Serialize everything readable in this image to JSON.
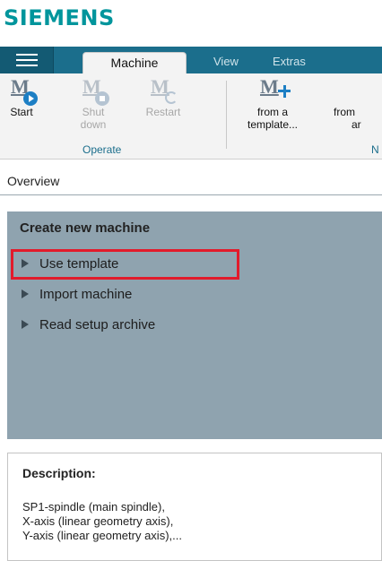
{
  "brand": {
    "logo_text": "SIEMENS",
    "color": "#00959c"
  },
  "tabbar": {
    "tabs": [
      {
        "label": "Machine",
        "active": true
      },
      {
        "label": "View",
        "active": false
      },
      {
        "label": "Extras",
        "active": false
      }
    ]
  },
  "ribbon": {
    "operate_group": {
      "label": "Operate",
      "buttons": [
        {
          "label": "Start",
          "enabled": true,
          "icon": "machine-start-icon"
        },
        {
          "label_line1": "Shut",
          "label_line2": "down",
          "enabled": false,
          "icon": "machine-shutdown-icon"
        },
        {
          "label": "Restart",
          "enabled": false,
          "icon": "machine-restart-icon"
        }
      ]
    },
    "new_group": {
      "label_partial": "N",
      "buttons": [
        {
          "label_line1": "from a",
          "label_line2": "template...",
          "icon": "machine-add-icon"
        },
        {
          "label_line1": "from",
          "label_line2": "ar"
        }
      ]
    }
  },
  "overview": {
    "label": "Overview"
  },
  "create_panel": {
    "title": "Create new machine",
    "items": [
      {
        "label": "Use template",
        "highlighted": true
      },
      {
        "label": "Import machine",
        "highlighted": false
      },
      {
        "label": "Read setup archive",
        "highlighted": false
      }
    ]
  },
  "description": {
    "title": "Description:",
    "lines": [
      "SP1-spindle (main spindle),",
      "X-axis (linear geometry axis),",
      "Y-axis (linear geometry axis),..."
    ]
  },
  "colors": {
    "tabbar": "#1b6e8c",
    "panel": "#8fa3af",
    "highlight_border": "#e21b2b",
    "start_badge": "#1d7fc4"
  }
}
